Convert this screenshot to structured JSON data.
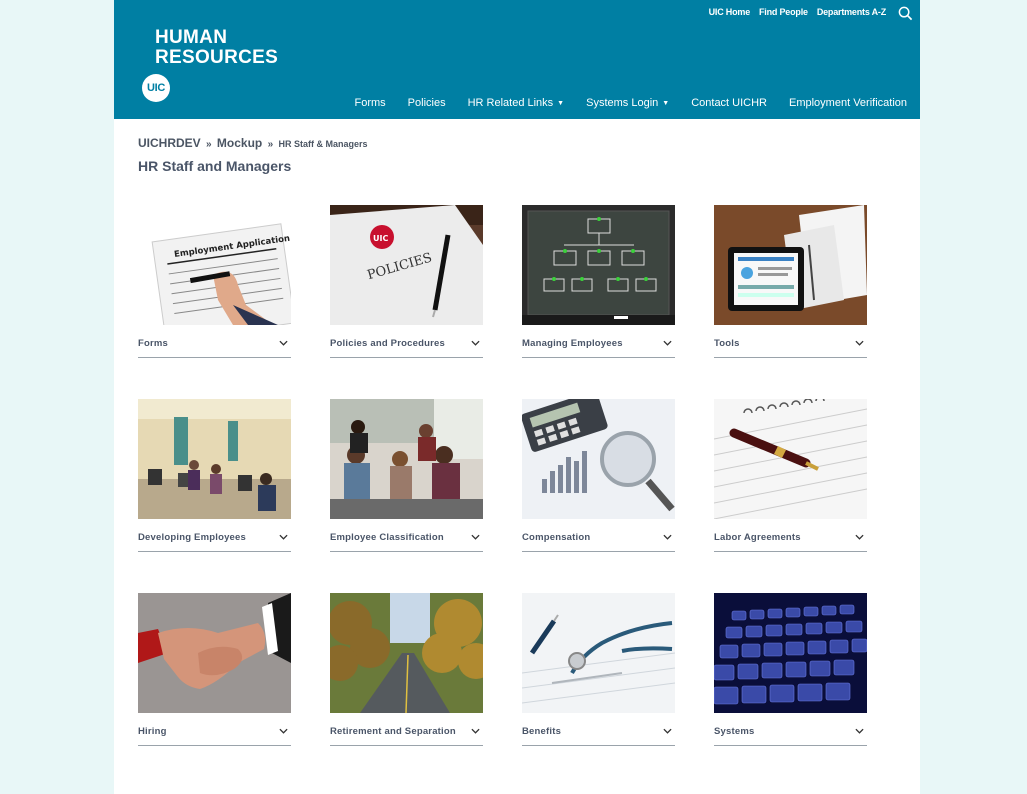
{
  "header": {
    "logo_line1": "HUMAN",
    "logo_line2": "RESOURCES",
    "logo_badge": "UIC",
    "utility_links": [
      "UIC Home",
      "Find People",
      "Departments A-Z"
    ],
    "nav": [
      {
        "label": "Forms",
        "dropdown": false
      },
      {
        "label": "Policies",
        "dropdown": false
      },
      {
        "label": "HR Related Links",
        "dropdown": true
      },
      {
        "label": "Systems Login",
        "dropdown": true
      },
      {
        "label": "Contact UICHR",
        "dropdown": false
      },
      {
        "label": "Employment Verification",
        "dropdown": false
      }
    ]
  },
  "breadcrumb": {
    "items": [
      "UICHRDEV",
      "Mockup"
    ],
    "separator": "»",
    "current": "HR Staff & Managers"
  },
  "page_title": "HR Staff and Managers",
  "tiles": [
    {
      "label": "Forms"
    },
    {
      "label": "Policies and Procedures"
    },
    {
      "label": "Managing Employees"
    },
    {
      "label": "Tools"
    },
    {
      "label": "Developing Employees"
    },
    {
      "label": "Employee Classification"
    },
    {
      "label": "Compensation"
    },
    {
      "label": "Labor Agreements"
    },
    {
      "label": "Hiring"
    },
    {
      "label": "Retirement and Separation"
    },
    {
      "label": "Benefits"
    },
    {
      "label": "Systems"
    }
  ],
  "image_text": {
    "forms": "Employment Application",
    "policies_badge": "UIC",
    "policies": "POLICIES"
  },
  "colors": {
    "header_bg": "#007fa3",
    "page_bg": "#e8f7f7",
    "label_text": "#4a5568"
  }
}
